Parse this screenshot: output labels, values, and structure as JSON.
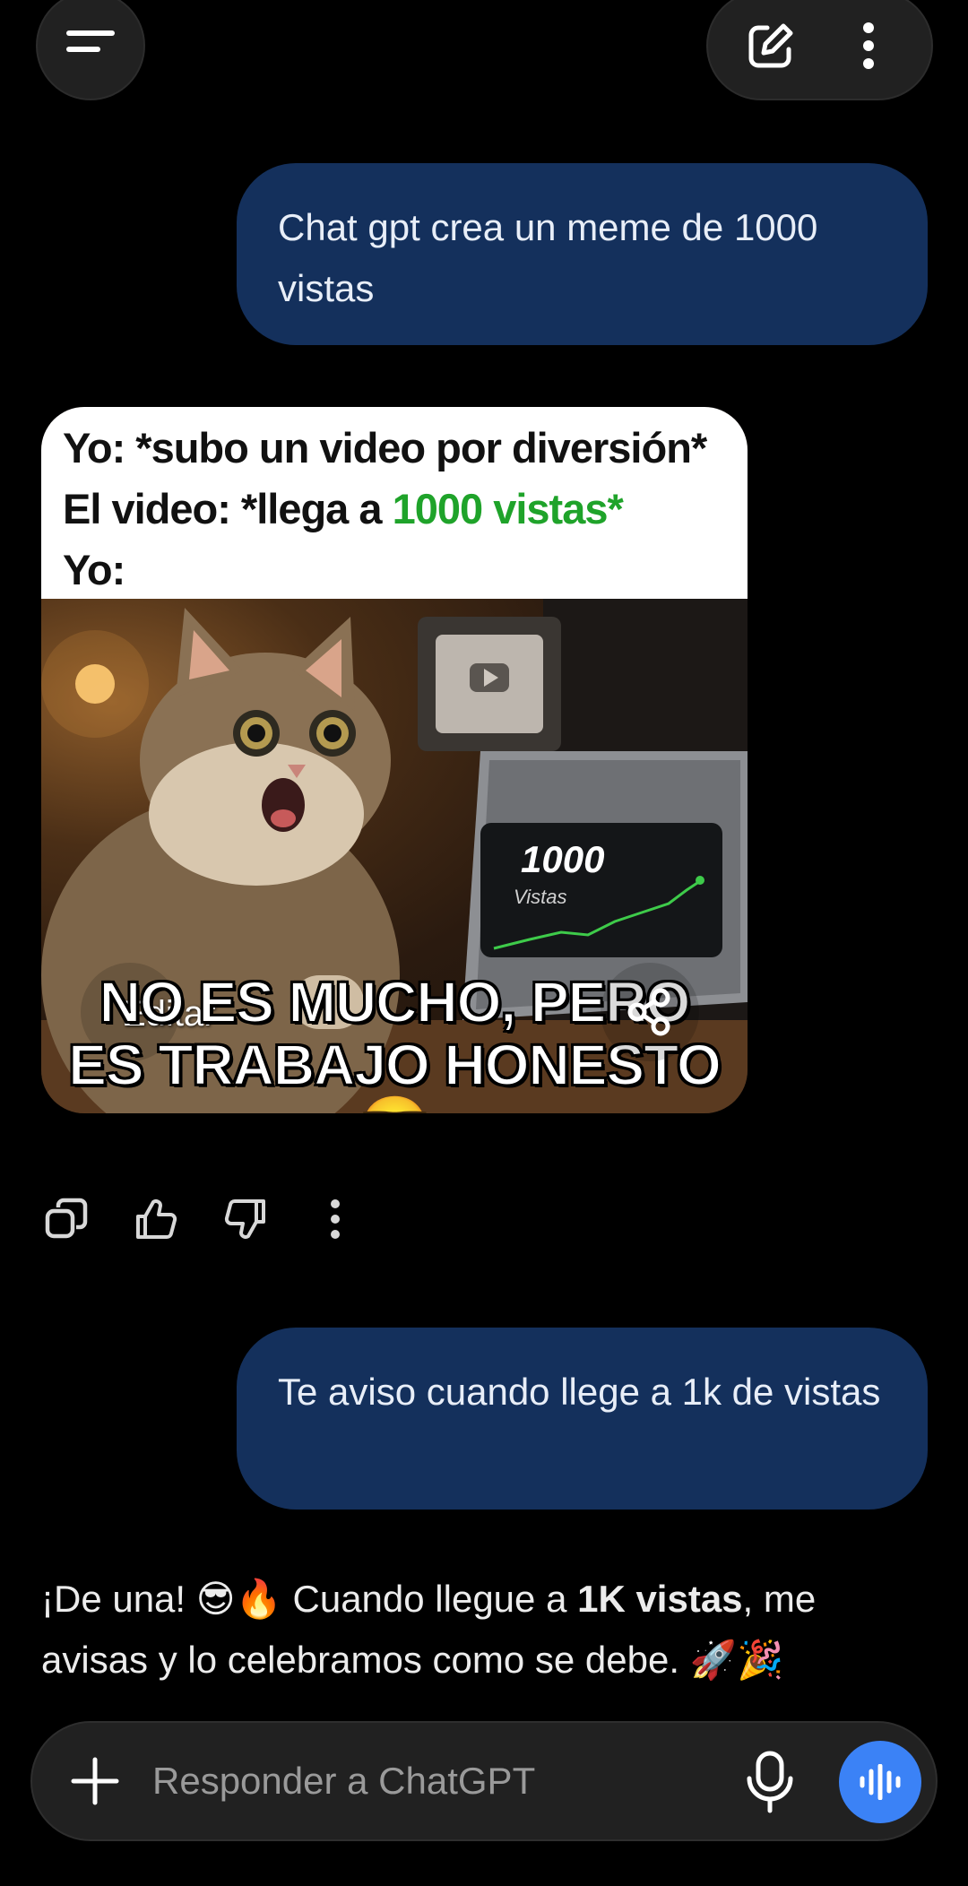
{
  "header": {
    "menu_icon": "menu-icon",
    "new_chat_icon": "edit-square-icon",
    "more_icon": "more-vertical-icon"
  },
  "messages": {
    "user_1": "Chat gpt crea un meme de 1000 vistas",
    "meme": {
      "caption_line1": "Yo: *subo un video por diversión*",
      "caption_line2_prefix": "El video: *llega a ",
      "caption_line2_highlight": "1000 vistas*",
      "caption_line3": "Yo:",
      "laptop_count": "1000",
      "laptop_label": "Vistas",
      "bottom_line1": "NO ES MUCHO, PERO",
      "bottom_line2": "ES TRABAJO HONESTO",
      "bottom_emoji": "😎",
      "edit_label": "Editar",
      "share_icon": "share-icon"
    },
    "actions": [
      "copy-icon",
      "thumbs-up-icon",
      "thumbs-down-icon",
      "more-vertical-icon"
    ],
    "user_2": "Te aviso cuando llege a 1k de vistas",
    "assistant": {
      "part1": "¡De una! 😎🔥 Cuando llegue a ",
      "bold": "1K vistas",
      "part2": ", me avisas y lo celebramos como se debe. 🚀🎉"
    }
  },
  "composer": {
    "placeholder": "Responder a ChatGPT",
    "plus_icon": "plus-icon",
    "mic_icon": "microphone-icon",
    "voice_icon": "voice-mode-icon"
  },
  "colors": {
    "user_bubble": "#14305c",
    "accent_blue": "#3b82f6",
    "meme_green": "#1fa32a"
  }
}
